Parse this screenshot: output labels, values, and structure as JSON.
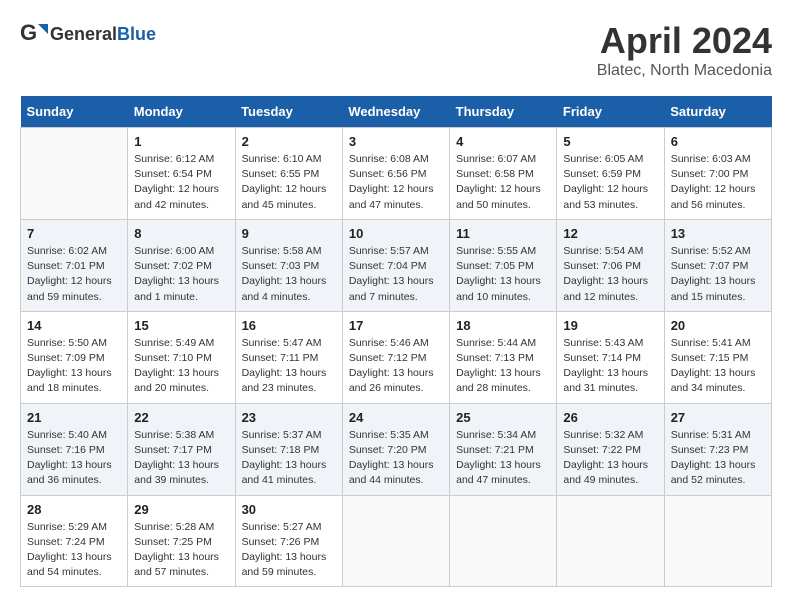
{
  "header": {
    "logo_general": "General",
    "logo_blue": "Blue",
    "month": "April 2024",
    "location": "Blatec, North Macedonia"
  },
  "weekdays": [
    "Sunday",
    "Monday",
    "Tuesday",
    "Wednesday",
    "Thursday",
    "Friday",
    "Saturday"
  ],
  "weeks": [
    [
      {
        "day": "",
        "info": ""
      },
      {
        "day": "1",
        "info": "Sunrise: 6:12 AM\nSunset: 6:54 PM\nDaylight: 12 hours\nand 42 minutes."
      },
      {
        "day": "2",
        "info": "Sunrise: 6:10 AM\nSunset: 6:55 PM\nDaylight: 12 hours\nand 45 minutes."
      },
      {
        "day": "3",
        "info": "Sunrise: 6:08 AM\nSunset: 6:56 PM\nDaylight: 12 hours\nand 47 minutes."
      },
      {
        "day": "4",
        "info": "Sunrise: 6:07 AM\nSunset: 6:58 PM\nDaylight: 12 hours\nand 50 minutes."
      },
      {
        "day": "5",
        "info": "Sunrise: 6:05 AM\nSunset: 6:59 PM\nDaylight: 12 hours\nand 53 minutes."
      },
      {
        "day": "6",
        "info": "Sunrise: 6:03 AM\nSunset: 7:00 PM\nDaylight: 12 hours\nand 56 minutes."
      }
    ],
    [
      {
        "day": "7",
        "info": "Sunrise: 6:02 AM\nSunset: 7:01 PM\nDaylight: 12 hours\nand 59 minutes."
      },
      {
        "day": "8",
        "info": "Sunrise: 6:00 AM\nSunset: 7:02 PM\nDaylight: 13 hours\nand 1 minute."
      },
      {
        "day": "9",
        "info": "Sunrise: 5:58 AM\nSunset: 7:03 PM\nDaylight: 13 hours\nand 4 minutes."
      },
      {
        "day": "10",
        "info": "Sunrise: 5:57 AM\nSunset: 7:04 PM\nDaylight: 13 hours\nand 7 minutes."
      },
      {
        "day": "11",
        "info": "Sunrise: 5:55 AM\nSunset: 7:05 PM\nDaylight: 13 hours\nand 10 minutes."
      },
      {
        "day": "12",
        "info": "Sunrise: 5:54 AM\nSunset: 7:06 PM\nDaylight: 13 hours\nand 12 minutes."
      },
      {
        "day": "13",
        "info": "Sunrise: 5:52 AM\nSunset: 7:07 PM\nDaylight: 13 hours\nand 15 minutes."
      }
    ],
    [
      {
        "day": "14",
        "info": "Sunrise: 5:50 AM\nSunset: 7:09 PM\nDaylight: 13 hours\nand 18 minutes."
      },
      {
        "day": "15",
        "info": "Sunrise: 5:49 AM\nSunset: 7:10 PM\nDaylight: 13 hours\nand 20 minutes."
      },
      {
        "day": "16",
        "info": "Sunrise: 5:47 AM\nSunset: 7:11 PM\nDaylight: 13 hours\nand 23 minutes."
      },
      {
        "day": "17",
        "info": "Sunrise: 5:46 AM\nSunset: 7:12 PM\nDaylight: 13 hours\nand 26 minutes."
      },
      {
        "day": "18",
        "info": "Sunrise: 5:44 AM\nSunset: 7:13 PM\nDaylight: 13 hours\nand 28 minutes."
      },
      {
        "day": "19",
        "info": "Sunrise: 5:43 AM\nSunset: 7:14 PM\nDaylight: 13 hours\nand 31 minutes."
      },
      {
        "day": "20",
        "info": "Sunrise: 5:41 AM\nSunset: 7:15 PM\nDaylight: 13 hours\nand 34 minutes."
      }
    ],
    [
      {
        "day": "21",
        "info": "Sunrise: 5:40 AM\nSunset: 7:16 PM\nDaylight: 13 hours\nand 36 minutes."
      },
      {
        "day": "22",
        "info": "Sunrise: 5:38 AM\nSunset: 7:17 PM\nDaylight: 13 hours\nand 39 minutes."
      },
      {
        "day": "23",
        "info": "Sunrise: 5:37 AM\nSunset: 7:18 PM\nDaylight: 13 hours\nand 41 minutes."
      },
      {
        "day": "24",
        "info": "Sunrise: 5:35 AM\nSunset: 7:20 PM\nDaylight: 13 hours\nand 44 minutes."
      },
      {
        "day": "25",
        "info": "Sunrise: 5:34 AM\nSunset: 7:21 PM\nDaylight: 13 hours\nand 47 minutes."
      },
      {
        "day": "26",
        "info": "Sunrise: 5:32 AM\nSunset: 7:22 PM\nDaylight: 13 hours\nand 49 minutes."
      },
      {
        "day": "27",
        "info": "Sunrise: 5:31 AM\nSunset: 7:23 PM\nDaylight: 13 hours\nand 52 minutes."
      }
    ],
    [
      {
        "day": "28",
        "info": "Sunrise: 5:29 AM\nSunset: 7:24 PM\nDaylight: 13 hours\nand 54 minutes."
      },
      {
        "day": "29",
        "info": "Sunrise: 5:28 AM\nSunset: 7:25 PM\nDaylight: 13 hours\nand 57 minutes."
      },
      {
        "day": "30",
        "info": "Sunrise: 5:27 AM\nSunset: 7:26 PM\nDaylight: 13 hours\nand 59 minutes."
      },
      {
        "day": "",
        "info": ""
      },
      {
        "day": "",
        "info": ""
      },
      {
        "day": "",
        "info": ""
      },
      {
        "day": "",
        "info": ""
      }
    ]
  ]
}
